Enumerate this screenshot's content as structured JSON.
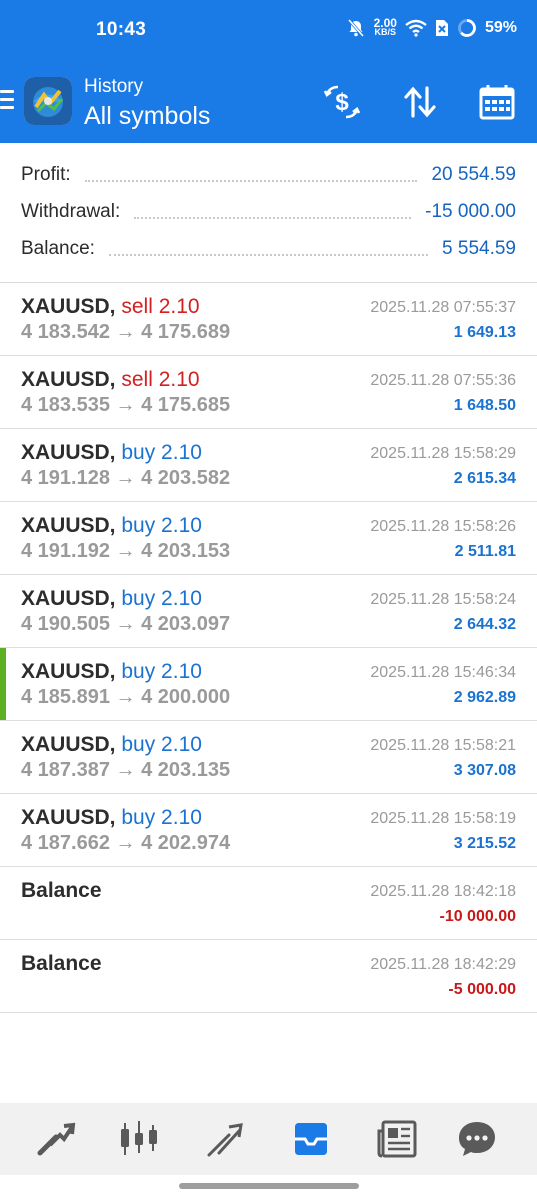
{
  "status_bar": {
    "time": "10:43",
    "net_speed": "2.00",
    "net_unit": "KB/S",
    "battery": "59%"
  },
  "header": {
    "subtitle": "History",
    "title": "All symbols",
    "icons": [
      "menu-icon",
      "app-logo",
      "currency-exchange-icon",
      "sort-icon",
      "calendar-icon"
    ]
  },
  "summary": [
    {
      "label": "Profit:",
      "value": "20 554.59"
    },
    {
      "label": "Withdrawal:",
      "value": "-15 000.00"
    },
    {
      "label": "Balance:",
      "value": "5 554.59"
    }
  ],
  "trades": [
    {
      "symbol": "XAUUSD,",
      "side": "sell",
      "side_text": "sell 2.10",
      "prices": "4 183.542 → 4 175.689",
      "time": "2025.11.28 07:55:37",
      "profit": "1 649.13"
    },
    {
      "symbol": "XAUUSD,",
      "side": "sell",
      "side_text": "sell 2.10",
      "prices": "4 183.535 → 4 175.685",
      "time": "2025.11.28 07:55:36",
      "profit": "1 648.50"
    },
    {
      "symbol": "XAUUSD,",
      "side": "buy",
      "side_text": "buy 2.10",
      "prices": "4 191.128 → 4 203.582",
      "time": "2025.11.28 15:58:29",
      "profit": "2 615.34"
    },
    {
      "symbol": "XAUUSD,",
      "side": "buy",
      "side_text": "buy 2.10",
      "prices": "4 191.192 → 4 203.153",
      "time": "2025.11.28 15:58:26",
      "profit": "2 511.81"
    },
    {
      "symbol": "XAUUSD,",
      "side": "buy",
      "side_text": "buy 2.10",
      "prices": "4 190.505 → 4 203.097",
      "time": "2025.11.28 15:58:24",
      "profit": "2 644.32"
    },
    {
      "symbol": "XAUUSD,",
      "side": "buy",
      "side_text": "buy 2.10",
      "prices": "4 185.891 → 4 200.000",
      "time": "2025.11.28 15:46:34",
      "profit": "2 962.89",
      "selected": true
    },
    {
      "symbol": "XAUUSD,",
      "side": "buy",
      "side_text": "buy 2.10",
      "prices": "4 187.387 → 4 203.135",
      "time": "2025.11.28 15:58:21",
      "profit": "3 307.08"
    },
    {
      "symbol": "XAUUSD,",
      "side": "buy",
      "side_text": "buy 2.10",
      "prices": "4 187.662 → 4 202.974",
      "time": "2025.11.28 15:58:19",
      "profit": "3 215.52"
    }
  ],
  "balance_ops": [
    {
      "label": "Balance",
      "time": "2025.11.28 18:42:18",
      "amount": "-10 000.00"
    },
    {
      "label": "Balance",
      "time": "2025.11.28 18:42:29",
      "amount": "-5 000.00"
    }
  ],
  "bottom_nav": [
    {
      "name": "quotes-icon",
      "active": false
    },
    {
      "name": "chart-icon",
      "active": false
    },
    {
      "name": "trade-icon",
      "active": false
    },
    {
      "name": "history-icon",
      "active": true
    },
    {
      "name": "news-icon",
      "active": false
    },
    {
      "name": "chat-icon",
      "active": false
    }
  ],
  "colors": {
    "header": "#1a7ae6",
    "sell": "#d32020",
    "buy": "#1a73d0",
    "negative": "#c81818",
    "selected_bar": "#5cb021",
    "nav_active": "#1a7ae6",
    "nav_inactive": "#5a5a5a"
  }
}
